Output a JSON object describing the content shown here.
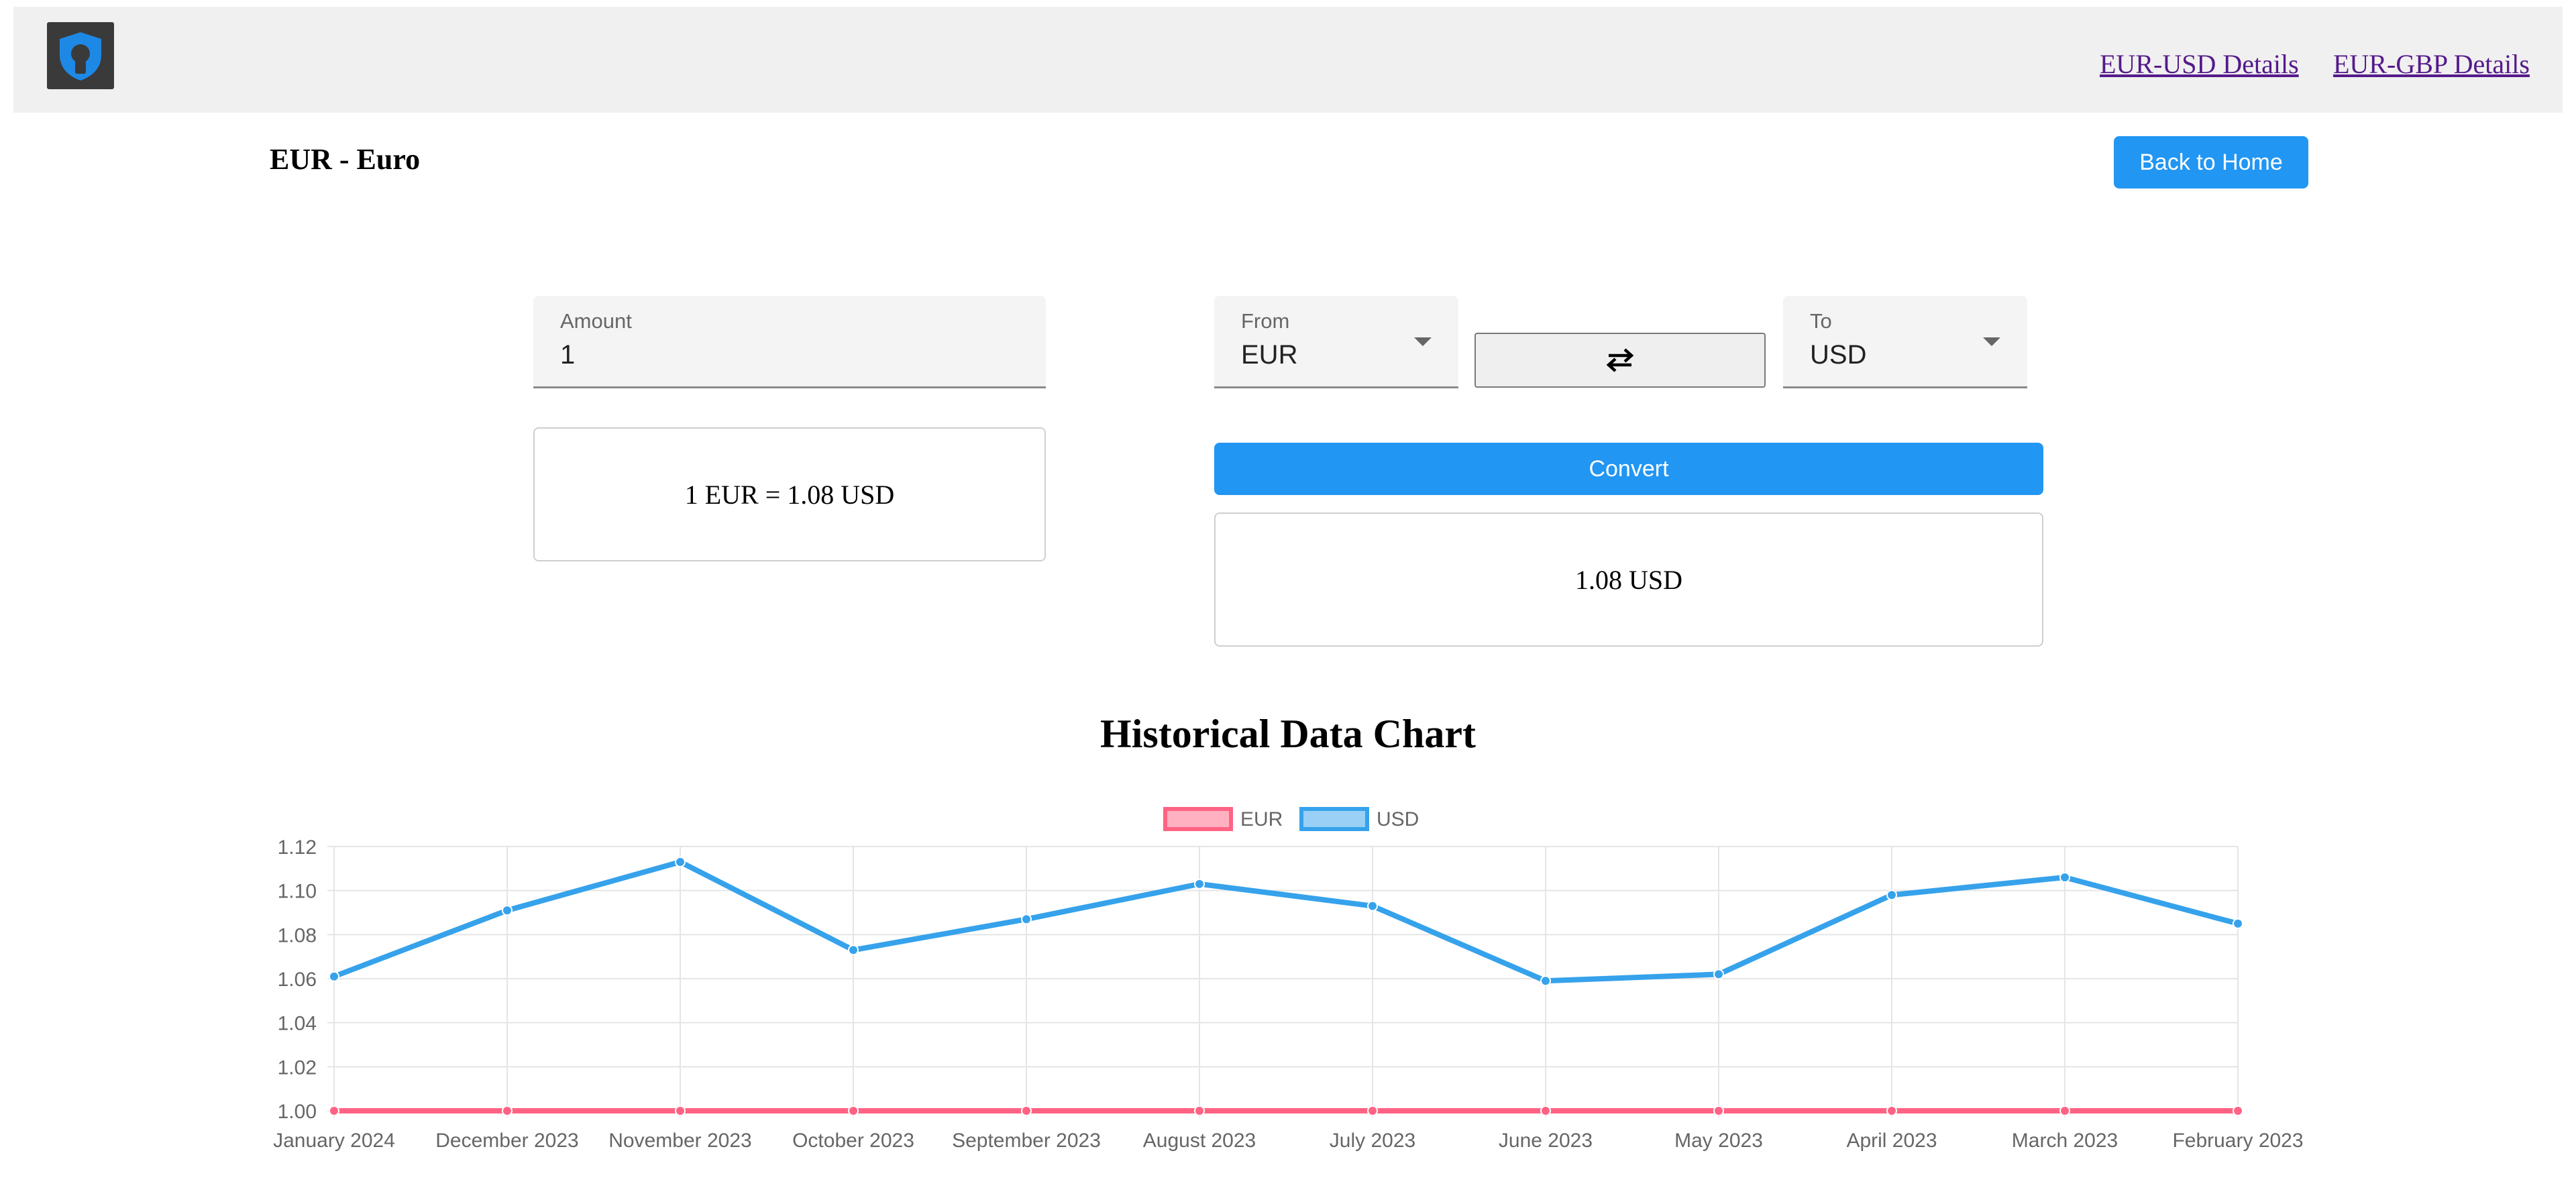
{
  "nav": {
    "links": [
      "EUR-USD Details",
      "EUR-GBP Details"
    ]
  },
  "header": {
    "title": "EUR - Euro",
    "back_label": "Back to Home"
  },
  "converter": {
    "amount_label": "Amount",
    "amount_value": "1",
    "from_label": "From",
    "from_value": "EUR",
    "to_label": "To",
    "to_value": "USD",
    "rate_text": "1 EUR = 1.08 USD",
    "convert_label": "Convert",
    "result_text": "1.08 USD"
  },
  "chart_section": {
    "title": "Historical Data Chart"
  },
  "colors": {
    "accent": "#2196f3",
    "eur": "#ff6384",
    "usd": "#36a2eb"
  },
  "chart_data": {
    "type": "line",
    "categories": [
      "January 2024",
      "December 2023",
      "November 2023",
      "October 2023",
      "September 2023",
      "August 2023",
      "July 2023",
      "June 2023",
      "May 2023",
      "April 2023",
      "March 2023",
      "February 2023"
    ],
    "series": [
      {
        "name": "EUR",
        "values": [
          1,
          1,
          1,
          1,
          1,
          1,
          1,
          1,
          1,
          1,
          1,
          1
        ]
      },
      {
        "name": "USD",
        "values": [
          1.061,
          1.091,
          1.113,
          1.073,
          1.087,
          1.103,
          1.093,
          1.059,
          1.062,
          1.098,
          1.106,
          1.085
        ]
      }
    ],
    "ylim": [
      1.0,
      1.12
    ],
    "yticks": [
      1.0,
      1.02,
      1.04,
      1.06,
      1.08,
      1.1,
      1.12
    ],
    "grid": true,
    "legend": "top-center"
  }
}
